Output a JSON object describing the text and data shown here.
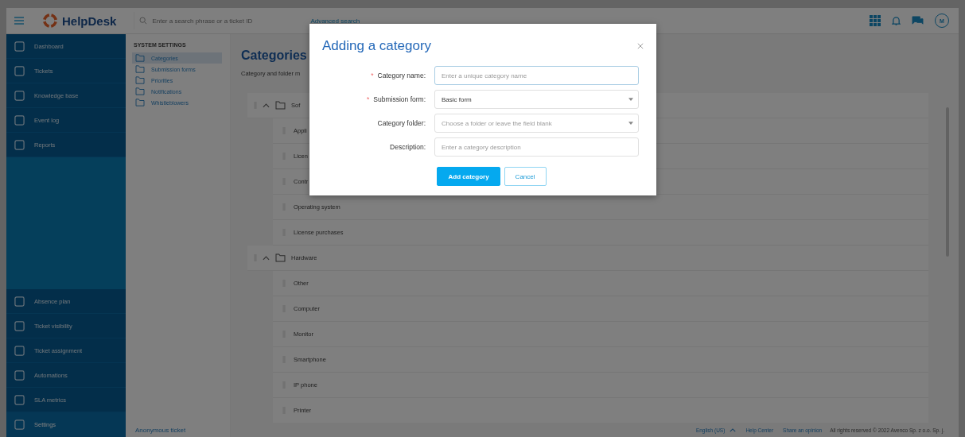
{
  "topbar": {
    "logo": "HelpDesk",
    "search": {
      "placeholder": "Enter a search phrase or a ticket ID"
    },
    "advanced_search": "Advanced search",
    "avatar": "M"
  },
  "sidebar": {
    "items": [
      {
        "label": "Dashboard",
        "selected": false
      },
      {
        "label": "Tickets",
        "selected": false
      },
      {
        "label": "Knowledge base",
        "selected": false
      },
      {
        "label": "Event log",
        "selected": false
      },
      {
        "label": "Reports",
        "selected": false
      }
    ],
    "bottom_items": [
      {
        "label": "Absence plan",
        "selected": false
      },
      {
        "label": "Ticket visibility",
        "selected": false
      },
      {
        "label": "Ticket assignment",
        "selected": false
      },
      {
        "label": "Automations",
        "selected": false
      },
      {
        "label": "SLA metrics",
        "selected": false
      },
      {
        "label": "Settings",
        "selected": true
      }
    ]
  },
  "settings_menu": {
    "heading": "SYSTEM SETTINGS",
    "items": [
      {
        "label": "Categories",
        "selected": true
      },
      {
        "label": "Submission forms",
        "selected": false
      },
      {
        "label": "Priorities",
        "selected": false
      },
      {
        "label": "Notifications",
        "selected": false
      },
      {
        "label": "Whistleblowers",
        "selected": false
      }
    ],
    "footer_link": "Anonymous ticket"
  },
  "page": {
    "title": "Categories",
    "subtitle": "Category and folder m",
    "folders": [
      {
        "name": "Sof",
        "expanded": true,
        "children": [
          {
            "name": "Appli"
          },
          {
            "name": "Licen"
          },
          {
            "name": "Contr"
          },
          {
            "name": "Operating system"
          },
          {
            "name": "License purchases"
          }
        ]
      },
      {
        "name": "Hardware",
        "expanded": true,
        "children": [
          {
            "name": "Other"
          },
          {
            "name": "Computer"
          },
          {
            "name": "Monitor"
          },
          {
            "name": "Smartphone"
          },
          {
            "name": "IP phone"
          },
          {
            "name": "Printer"
          }
        ]
      }
    ]
  },
  "footer": {
    "language": "English (US)",
    "links": [
      "Help Center",
      "Share an opinion"
    ],
    "copyright": "All rights reserved © 2022 Avenco Sp. z o.o. Sp. j."
  },
  "dialog": {
    "title": "Adding a category",
    "required_mark": "*",
    "fields": [
      {
        "label": "Category name:",
        "required": true,
        "kind": "input",
        "placeholder": "Enter a unique category name",
        "focused": true
      },
      {
        "label": "Submission form:",
        "required": true,
        "kind": "select",
        "value": "Basic form",
        "focused": false
      },
      {
        "label": "Category folder:",
        "required": false,
        "kind": "select",
        "placeholder": "Choose a folder or leave the field blank",
        "focused": false
      },
      {
        "label": "Description:",
        "required": false,
        "kind": "input",
        "placeholder": "Enter a category description",
        "focused": false
      }
    ],
    "buttons": [
      {
        "label": "Add category",
        "kind": "primary"
      },
      {
        "label": "Cancel",
        "kind": "secondary"
      }
    ]
  }
}
